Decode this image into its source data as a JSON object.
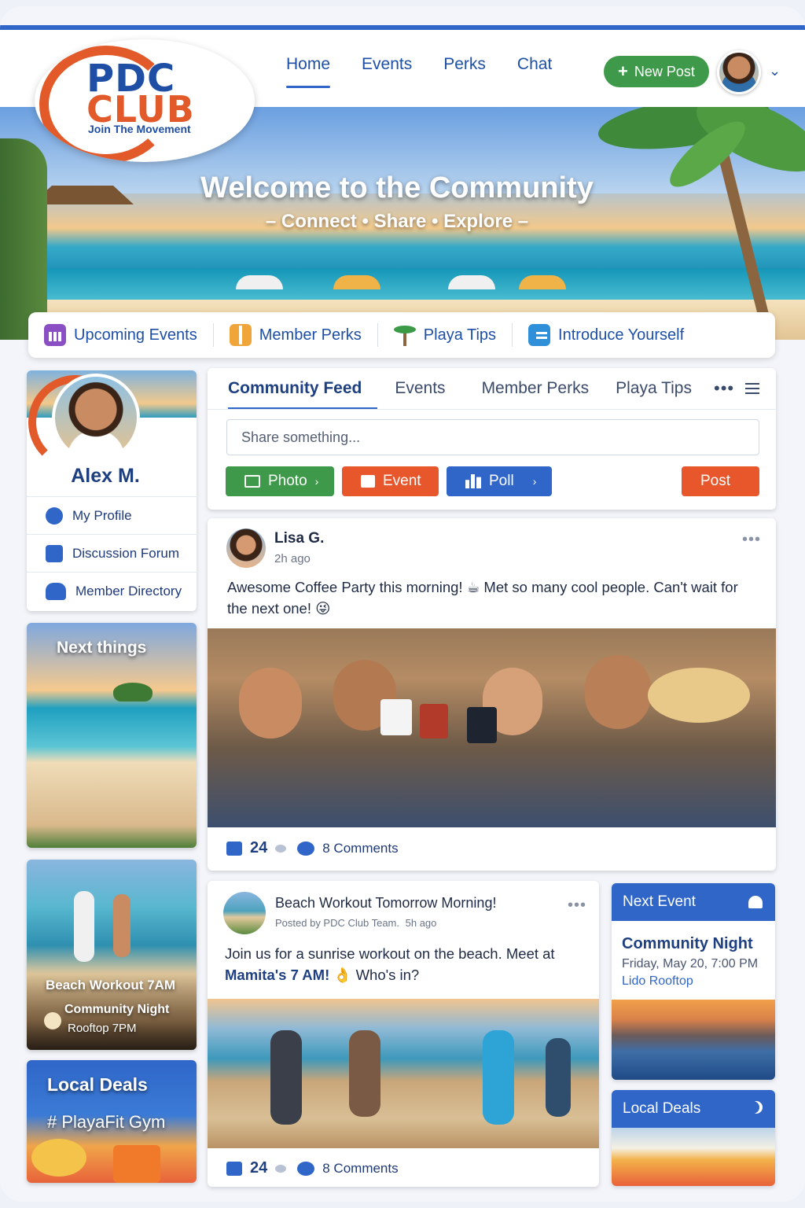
{
  "logo": {
    "line1": "PDC",
    "line2": "CLUB",
    "tagline": "Join The Movement"
  },
  "nav": {
    "items": [
      {
        "label": "Home",
        "active": true
      },
      {
        "label": "Events"
      },
      {
        "label": "Perks"
      },
      {
        "label": "Chat"
      }
    ],
    "new_post_label": "New Post",
    "new_post_icon": "plus-icon"
  },
  "hero": {
    "title": "Welcome to the Community",
    "subtitle": "– Connect • Share • Explore –"
  },
  "quick_links": [
    {
      "label": "Upcoming Events",
      "icon": "calendar-icon",
      "color": "#8b4fc4"
    },
    {
      "label": "Member Perks",
      "icon": "gift-icon",
      "color": "#f0a53a"
    },
    {
      "label": "Playa Tips",
      "icon": "palm-icon",
      "color": "#3a9a45"
    },
    {
      "label": "Introduce Yourself",
      "icon": "id-card-icon",
      "color": "#2f8fd8"
    }
  ],
  "profile": {
    "name": "Alex M.",
    "links": [
      {
        "label": "My Profile",
        "icon": "user-icon"
      },
      {
        "label": "Discussion Forum",
        "icon": "chat-icon"
      },
      {
        "label": "Member Directory",
        "icon": "users-icon"
      }
    ]
  },
  "left_cards": {
    "next_things": "Next things",
    "workout": {
      "line1": "Beach Workout 7AM",
      "line2": "Community Night",
      "line3": "Rooftop 7PM"
    },
    "local_deals": {
      "title": "Local Deals",
      "subtitle": "# PlayaFit Gym"
    }
  },
  "feed": {
    "tabs": [
      {
        "label": "Community Feed",
        "active": true
      },
      {
        "label": "Events"
      },
      {
        "label": "Member Perks"
      },
      {
        "label": "Playa Tips"
      }
    ],
    "share_placeholder": "Share something...",
    "buttons": {
      "photo": "Photo",
      "event": "Event",
      "poll": "Poll",
      "post": "Post"
    },
    "colors": {
      "photo": "#3e9a4a",
      "event": "#e8562b",
      "poll": "#2f66c8",
      "post": "#e8562b"
    }
  },
  "posts": [
    {
      "author": "Lisa G.",
      "time": "2h ago",
      "text": "Awesome Coffee Party this morning! ☕ Met so many cool people. Can't wait for the next one! 😜",
      "likes": "24",
      "comments": "8 Comments"
    },
    {
      "author": "Beach Workout Tomorrow Morning!",
      "meta": "Posted by PDC Club Team.",
      "time": "5h ago",
      "text_before": "Join us for a sunrise workout on the beach. Meet at",
      "text_bold": "Mamita's 7 AM!",
      "text_after": "👌 Who's in?",
      "likes": "24",
      "comments": "8 Comments"
    }
  ],
  "next_event": {
    "header": "Next Event",
    "title": "Community Night",
    "date": "Friday, May 20, 7:00 PM",
    "place": "Lido Rooftop"
  },
  "local_deals_widget": {
    "header": "Local Deals"
  }
}
